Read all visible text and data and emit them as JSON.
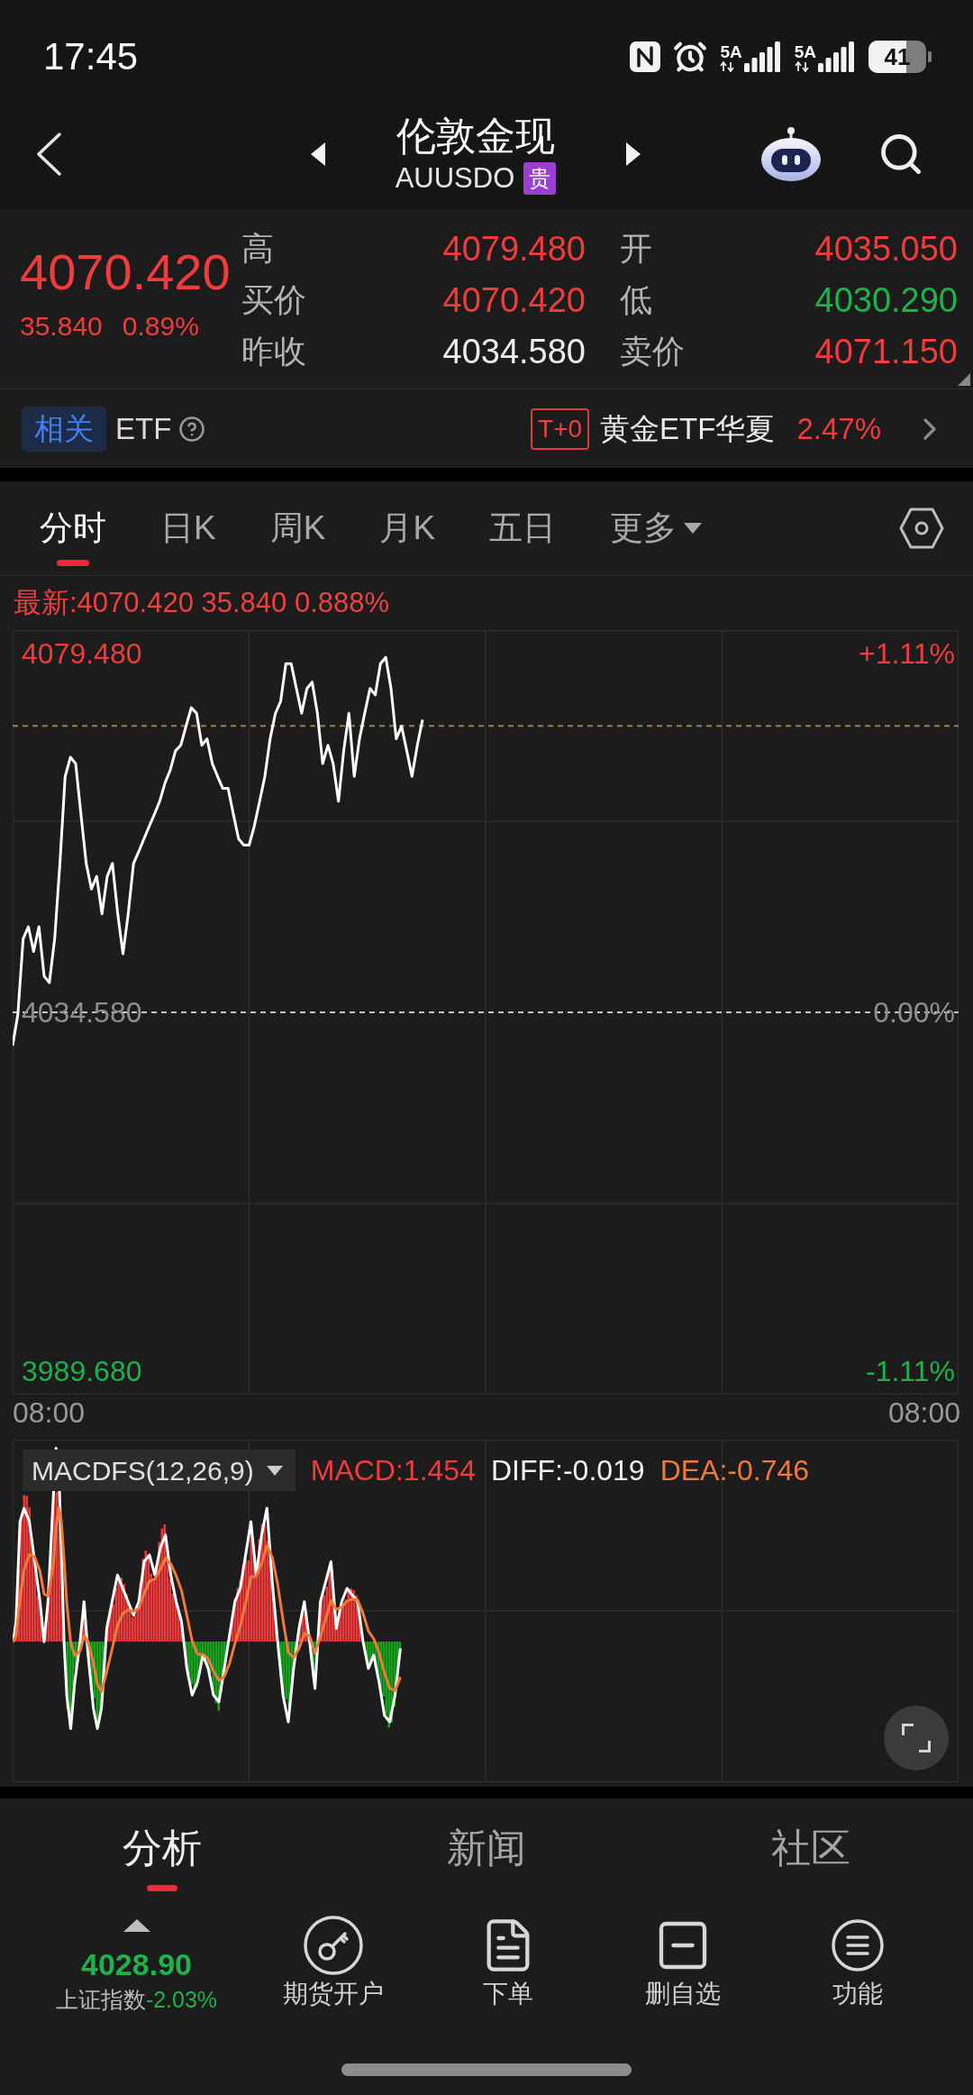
{
  "status_bar": {
    "time": "17:45",
    "network_labels": [
      "5A",
      "5A"
    ],
    "battery": "41"
  },
  "header": {
    "title": "伦敦金现",
    "code": "AUUSDO",
    "badge": "贵"
  },
  "quote": {
    "price": "4070.420",
    "change": "35.840",
    "change_percent": "0.89%",
    "color": "#f23c3c",
    "stats": [
      {
        "label": "高",
        "value": "4079.480",
        "color": "#f23c3c"
      },
      {
        "label": "开",
        "value": "4035.050",
        "color": "#f23c3c"
      },
      {
        "label": "买价",
        "value": "4070.420",
        "color": "#f23c3c"
      },
      {
        "label": "低",
        "value": "4030.290",
        "color": "#1db24b"
      },
      {
        "label": "昨收",
        "value": "4034.580",
        "color": "#ededed"
      },
      {
        "label": "卖价",
        "value": "4071.150",
        "color": "#f23c3c"
      }
    ]
  },
  "related_etf": {
    "tag": "相关",
    "label": "ETF",
    "fund_tag": "T+0",
    "fund_name": "黄金ETF华夏",
    "fund_change": "2.47%",
    "color": "#f23c3c"
  },
  "chart_tabs": [
    {
      "label": "分时",
      "selected": true,
      "kind": "tab"
    },
    {
      "label": "日K",
      "selected": false,
      "kind": "tab"
    },
    {
      "label": "周K",
      "selected": false,
      "kind": "tab"
    },
    {
      "label": "月K",
      "selected": false,
      "kind": "tab"
    },
    {
      "label": "五日",
      "selected": false,
      "kind": "tab"
    },
    {
      "label": "更多",
      "selected": false,
      "kind": "dropdown"
    }
  ],
  "intraday_chart": {
    "latest": "最新:4070.420 35.840 0.888%",
    "right_labels": [
      "+1.11%",
      "0.00%",
      "-1.11%"
    ],
    "time_labels": [
      "08:00",
      "08:00"
    ],
    "chart_data": {
      "type": "line",
      "series": [
        {
          "color": "#ffffff",
          "values": [
            4030.4,
            4034.3,
            4043.8,
            4045.3,
            4042.2,
            4045.3,
            4039.1,
            4038.3,
            4043.8,
            4053.2,
            4064.1,
            4066.5,
            4065.7,
            4059.4,
            4053.2,
            4050.0,
            4051.6,
            4046.9,
            4051.6,
            4053.2,
            4046.9,
            4041.9,
            4046.9,
            4053.2,
            4054.7,
            4056.3,
            4057.9,
            4059.4,
            4061.0,
            4063.3,
            4064.9,
            4067.3,
            4068.0,
            4070.4,
            4072.7,
            4072.0,
            4068.0,
            4068.8,
            4065.7,
            4064.1,
            4062.6,
            4062.6,
            4059.4,
            4056.3,
            4055.5,
            4055.5,
            4057.9,
            4061.0,
            4064.1,
            4068.8,
            4072.0,
            4073.5,
            4078.2,
            4078.2,
            4075.1,
            4072.0,
            4075.1,
            4075.9,
            4072.0,
            4065.7,
            4068.0,
            4065.7,
            4061.0,
            4067.3,
            4072.0,
            4064.1,
            4068.8,
            4072.0,
            4075.1,
            4074.3,
            4078.2,
            4079.0,
            4075.1,
            4068.8,
            4070.4,
            4067.3,
            4064.1,
            4068.0,
            4071.2,
            null,
            null,
            null,
            null,
            null,
            null,
            null,
            null,
            null,
            null,
            null,
            null,
            null,
            null,
            null,
            null,
            null,
            null,
            null,
            null,
            null,
            null,
            null,
            null,
            null,
            null,
            null,
            null,
            null,
            null,
            null,
            null,
            null,
            null,
            null,
            null,
            null,
            null,
            null,
            null,
            null,
            null,
            null,
            null,
            null,
            null,
            null,
            null,
            null,
            null,
            null,
            null,
            null,
            null,
            null,
            null,
            null,
            null,
            null,
            null,
            null,
            null,
            null,
            null,
            null,
            null,
            null,
            null,
            null,
            null,
            null,
            null,
            null,
            null,
            null,
            null,
            null,
            null,
            null,
            null,
            null,
            null,
            null,
            null,
            null,
            null,
            null,
            null,
            null,
            null,
            null,
            null,
            null,
            null,
            null,
            null,
            null,
            null,
            null,
            null,
            null,
            null
          ]
        }
      ],
      "ylim": [
        3986.75,
        4082.41
      ],
      "yticks": [
        {
          "value": 4079.48,
          "label": "4079.480"
        },
        {
          "value": 4034.58,
          "label": "4034.580"
        },
        {
          "value": 3989.68,
          "label": "3989.680"
        }
      ],
      "ref_lines": [
        {
          "axis": "y",
          "value": 4070.42,
          "color": "#9c7b4c"
        },
        {
          "axis": "y",
          "value": 4034.58,
          "color": "#c4c4c4"
        }
      ]
    }
  },
  "macd": {
    "indicator": "MACDFS(12,26,9)",
    "values": [
      {
        "label": "MACD:1.454",
        "color": "#f03c3c"
      },
      {
        "label": "DIFF:-0.019",
        "color": "#f2f2f2"
      },
      {
        "label": "DEA:-0.746",
        "color": "#f07a3a"
      }
    ]
  },
  "bottom_tabs": [
    {
      "label": "分析",
      "selected": true
    },
    {
      "label": "新闻",
      "selected": false
    },
    {
      "label": "社区",
      "selected": false
    }
  ],
  "toolbar": {
    "index": {
      "value": "4028.90",
      "name": "上证指数",
      "change": "-2.03%",
      "color": "#1db24b"
    },
    "actions": [
      {
        "label": "期货开户",
        "kind": "account"
      },
      {
        "label": "下单",
        "kind": "order"
      },
      {
        "label": "删自选",
        "kind": "unwatch"
      },
      {
        "label": "功能",
        "kind": "menu"
      }
    ]
  }
}
